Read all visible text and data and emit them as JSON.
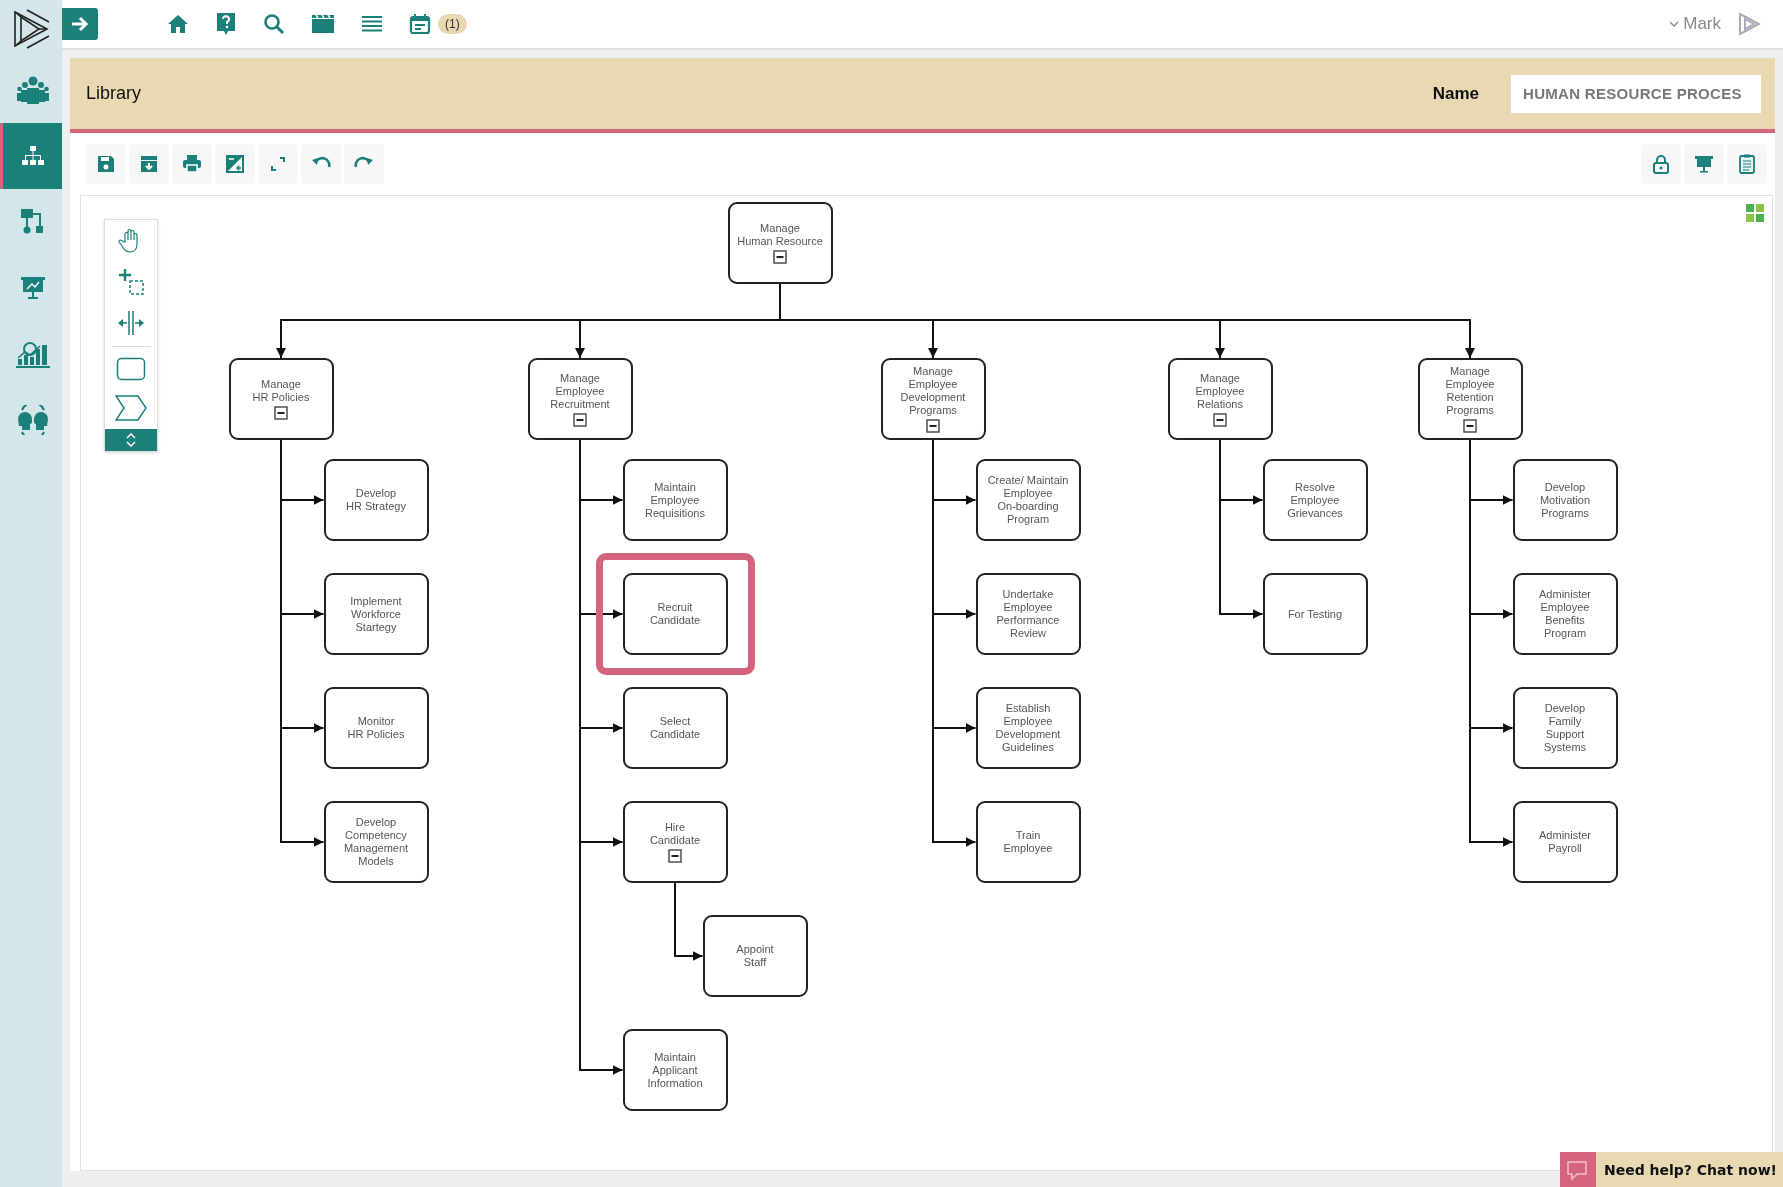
{
  "sidebar": {
    "items": [
      {
        "selected": false
      },
      {
        "selected": true
      },
      {
        "selected": false
      },
      {
        "selected": false
      },
      {
        "selected": false
      },
      {
        "selected": false
      }
    ]
  },
  "topbar": {
    "badge": "(1)",
    "user": "Mark"
  },
  "header": {
    "title": "Library",
    "name_label": "Name",
    "name_value": "HUMAN RESOURCE PROCES"
  },
  "diagram": {
    "root": {
      "label": "Manage\nHuman Resource",
      "expanded": true,
      "selected": false,
      "children": [
        {
          "label": "Manage\nHR Policies",
          "expanded": true,
          "selected": false,
          "children": [
            {
              "label": "Develop\nHR Strategy",
              "selected": false
            },
            {
              "label": "Implement\nWorkforce\nStartegy",
              "selected": false
            },
            {
              "label": "Monitor\nHR Policies",
              "selected": false
            },
            {
              "label": "Develop\nCompetency\nManagement\nModels",
              "selected": false
            }
          ]
        },
        {
          "label": "Manage\nEmployee\nRecruitment",
          "expanded": true,
          "selected": false,
          "children": [
            {
              "label": "Maintain\nEmployee\nRequisitions",
              "selected": false
            },
            {
              "label": "Recruit\nCandidate",
              "selected": true
            },
            {
              "label": "Select\nCandidate",
              "selected": false
            },
            {
              "label": "Hire\nCandidate",
              "expanded": true,
              "selected": false,
              "children": [
                {
                  "label": "Appoint\nStaff",
                  "selected": false
                }
              ]
            },
            {
              "label": "Maintain\nApplicant\nInformation",
              "selected": false
            }
          ]
        },
        {
          "label": "Manage\nEmployee\nDevelopment\nPrograms",
          "expanded": true,
          "selected": false,
          "children": [
            {
              "label": "Create/ Maintain\nEmployee\nOn-boarding\nProgram",
              "selected": false
            },
            {
              "label": "Undertake\nEmployee\nPerformance\nReview",
              "selected": false
            },
            {
              "label": "Establish\nEmployee\nDevelopment\nGuidelines",
              "selected": false
            },
            {
              "label": "Train\nEmployee",
              "selected": false
            }
          ]
        },
        {
          "label": "Manage\nEmployee\nRelations",
          "expanded": true,
          "selected": false,
          "children": [
            {
              "label": "Resolve\nEmployee\nGrievances",
              "selected": false
            },
            {
              "label": "For Testing",
              "selected": false
            }
          ]
        },
        {
          "label": "Manage\nEmployee\nRetention\nPrograms",
          "expanded": true,
          "selected": false,
          "children": [
            {
              "label": "Develop\nMotivation\nPrograms",
              "selected": false
            },
            {
              "label": "Administer\nEmployee\nBenefits\nProgram",
              "selected": false
            },
            {
              "label": "Develop\nFamily\nSupport\nSystems",
              "selected": false
            },
            {
              "label": "Administer\nPayroll",
              "selected": false
            }
          ]
        }
      ]
    }
  },
  "chat": {
    "label": "Need help? Chat now!"
  }
}
